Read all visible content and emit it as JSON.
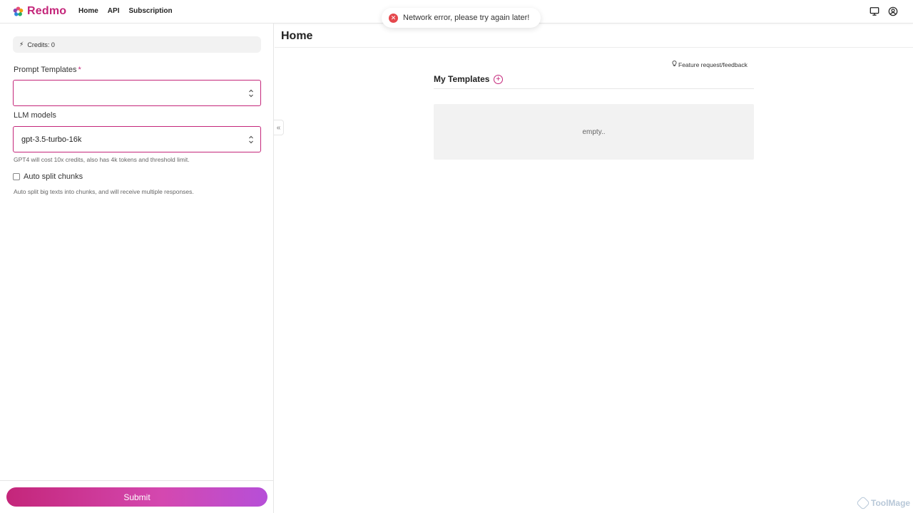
{
  "header": {
    "brand": "Redmo",
    "nav": [
      {
        "label": "Home"
      },
      {
        "label": "API"
      },
      {
        "label": "Subscription"
      }
    ],
    "icons": [
      "monitor-icon",
      "user-circle-icon"
    ]
  },
  "toast": {
    "message": "Network error, please try again later!",
    "type": "error",
    "color": "#e5484d"
  },
  "sidebar": {
    "credits_label": "Credits: 0",
    "prompt_templates_label": "Prompt Templates",
    "required_mark": "*",
    "prompt_templates_value": "",
    "llm_models_label": "LLM models",
    "llm_models_value": "gpt-3.5-turbo-16k",
    "llm_hint": "GPT4 will cost 10x credits, also has 4k tokens and threshold limit.",
    "auto_split_label": "Auto split chunks",
    "auto_split_checked": false,
    "auto_split_hint": "Auto split big texts into chunks, and will receive multiple responses.",
    "submit_label": "Submit"
  },
  "main": {
    "title": "Home",
    "feedback_label": "Feature request/feedback",
    "templates_title": "My Templates",
    "empty_text": "empty.."
  },
  "watermark": "ToolMage",
  "colors": {
    "accent": "#c4267a",
    "error": "#e5484d"
  }
}
